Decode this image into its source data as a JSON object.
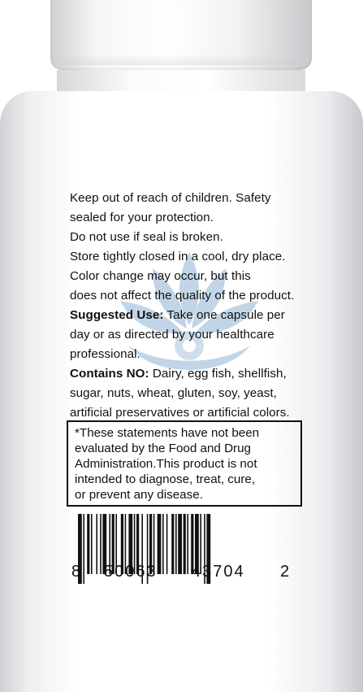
{
  "label": {
    "lines": [
      "Keep out of reach of children. Safety",
      "sealed for your protection.",
      "Do not use if seal is broken.",
      "Store tightly closed in a cool, dry place.",
      "Color change may occur, but this",
      "does not affect the quality of the product."
    ],
    "suggested_use_heading": "Suggested Use:",
    "suggested_use_lines": [
      " Take one capsule per",
      "day or as directed by your healthcare",
      "professional."
    ],
    "contains_heading": "Contains NO:",
    "contains_lines": [
      " Dairy, egg fish, shellfish,",
      "sugar, nuts, wheat, gluten, soy, yeast,",
      "artificial preservatives or artificial colors."
    ]
  },
  "notice": {
    "lines": [
      "*These statements have not been",
      "evaluated by the Food and Drug",
      "Administration.This product is not",
      "intended to diagnose, treat, cure,",
      "or prevent  any disease."
    ]
  },
  "barcode": {
    "digit_first": "8",
    "group_left": "50063",
    "group_right": "43704",
    "digit_last": "2"
  },
  "watermark": {
    "icon": "lotus-logo-icon"
  }
}
